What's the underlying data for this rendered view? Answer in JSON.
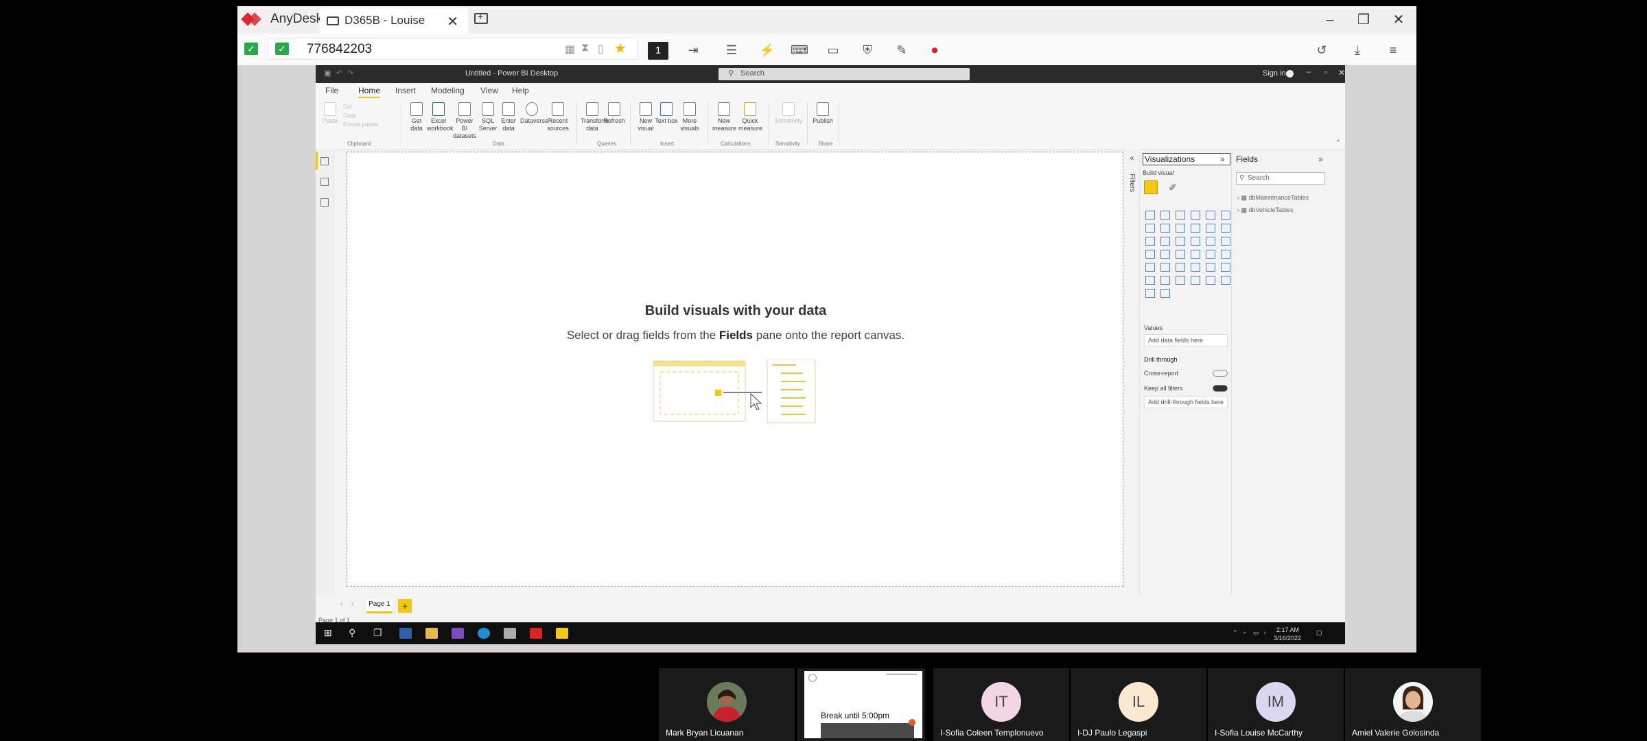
{
  "anydesk": {
    "brand": "AnyDesk",
    "tab_label": "D365B - Louise",
    "address": "776842203",
    "monitor_number": "1",
    "window_buttons": [
      "–",
      "❐",
      "✕"
    ]
  },
  "pbi": {
    "window_title": "Untitled - Power BI Desktop",
    "search_placeholder": "Search",
    "sign_in": "Sign in",
    "ribbon_tabs": [
      "File",
      "Home",
      "Insert",
      "Modeling",
      "View",
      "Help"
    ],
    "ribbon": {
      "paste": "Paste",
      "cut": "Cut",
      "copy": "Copy",
      "format_painter": "Format painter",
      "get_data": "Get data",
      "excel_workbook": "Excel workbook",
      "power_bi_datasets": "Power BI datasets",
      "sql_server": "SQL Server",
      "enter_data": "Enter data",
      "dataverse": "Dataverse",
      "recent_sources": "Recent sources",
      "transform_data": "Transform data",
      "refresh": "Refresh",
      "new_visual": "New visual",
      "text_box": "Text box",
      "more_visuals": "More visuals",
      "new_measure": "New measure",
      "quick_measure": "Quick measure",
      "sensitivity": "Sensitivity",
      "publish": "Publish",
      "groups": [
        "Clipboard",
        "Data",
        "Queries",
        "Insert",
        "Calculations",
        "Sensitivity",
        "Share"
      ]
    },
    "canvas": {
      "title": "Build visuals with your data",
      "sub_before": "Select or drag fields from the ",
      "sub_bold": "Fields",
      "sub_after": " pane onto the report canvas."
    },
    "filters_label": "Filters",
    "visualizations": {
      "title": "Visualizations",
      "build_visual": "Build visual",
      "values_label": "Values",
      "values_placeholder": "Add data fields here",
      "drill_through": "Drill through",
      "cross_report": "Cross-report",
      "cross_report_state": "Off",
      "keep_all_filters": "Keep all filters",
      "keep_all_filters_state": "On",
      "drill_placeholder": "Add drill-through fields here"
    },
    "fields": {
      "title": "Fields",
      "search_placeholder": "Search",
      "tables": [
        "dbMaintenanceTables",
        "dbVehicleTables"
      ]
    },
    "page_tab": "Page 1",
    "page_add": "+",
    "page_of": "Page 1 of 1",
    "clock_time": "2:17 AM",
    "clock_date": "3/16/2022"
  },
  "participants": [
    {
      "name": "Mark Bryan Licuanan",
      "type": "photo"
    },
    {
      "name": "",
      "type": "slide",
      "slide_text": "Break until 5:00pm"
    },
    {
      "name": "I-Sofia Coleen Templonuevo",
      "initials": "IT",
      "color": "#f3d6e6"
    },
    {
      "name": "I-DJ Paulo Legaspi",
      "initials": "IL",
      "color": "#fbe8d0"
    },
    {
      "name": "I-Sofia Louise McCarthy",
      "initials": "IM",
      "color": "#dcd7f0"
    },
    {
      "name": "Amiel Valerie Golosinda",
      "type": "photo"
    }
  ]
}
